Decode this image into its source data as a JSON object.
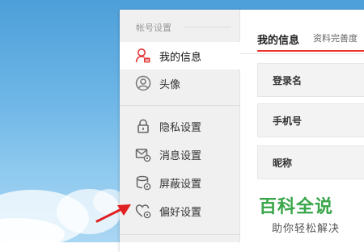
{
  "sidebar": {
    "group_title": "帐号设置",
    "items": [
      {
        "label": "我的信息",
        "icon": "user-icon",
        "active": true
      },
      {
        "label": "头像",
        "icon": "avatar-icon",
        "active": false
      },
      {
        "label": "隐私设置",
        "icon": "lock-icon",
        "active": false
      },
      {
        "label": "消息设置",
        "icon": "message-settings-icon",
        "active": false
      },
      {
        "label": "屏蔽设置",
        "icon": "block-settings-icon",
        "active": false
      },
      {
        "label": "偏好设置",
        "icon": "heart-settings-icon",
        "active": false
      }
    ]
  },
  "tabs": [
    {
      "label": "我的信息",
      "active": true
    },
    {
      "label": "资料完善度",
      "active": false
    }
  ],
  "fields": [
    {
      "label": "登录名"
    },
    {
      "label": "手机号"
    },
    {
      "label": "昵称"
    }
  ],
  "watermark": {
    "title": "百科全说",
    "subtitle": "助你轻松解决"
  },
  "colors": {
    "accent": "#e33333",
    "sidebar_bg": "#f0f0f0",
    "watermark_green": "#3aa64a",
    "arrow": "#e02020"
  }
}
